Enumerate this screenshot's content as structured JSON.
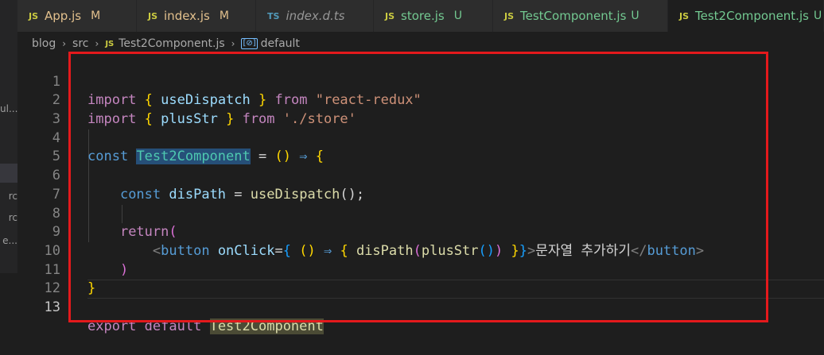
{
  "tabs": [
    {
      "icon": "JS",
      "label": "App.js",
      "status": "M",
      "state": "modified",
      "italic": false,
      "active": false
    },
    {
      "icon": "JS",
      "label": "index.js",
      "status": "M",
      "state": "modified",
      "italic": false,
      "active": false
    },
    {
      "icon": "TS",
      "label": "index.d.ts",
      "status": "",
      "state": "normal",
      "italic": true,
      "active": false
    },
    {
      "icon": "JS",
      "label": "store.js",
      "status": "U",
      "state": "new",
      "italic": false,
      "active": false
    },
    {
      "icon": "JS",
      "label": "TestComponent.js",
      "status": "U",
      "state": "new",
      "italic": false,
      "active": false
    },
    {
      "icon": "JS",
      "label": "Test2Component.js",
      "status": "U",
      "state": "new",
      "italic": false,
      "active": true
    }
  ],
  "breadcrumb": {
    "items": [
      "blog",
      "src"
    ],
    "file_icon": "JS",
    "file": "Test2Component.js",
    "symbol_icon": "[⊘]",
    "symbol": "default"
  },
  "sidebar_fragments": [
    "ul...",
    "rc",
    "rc",
    "e..."
  ],
  "editor": {
    "current_line": 13,
    "line_numbers": [
      "1",
      "2",
      "3",
      "4",
      "5",
      "6",
      "7",
      "8",
      "9",
      "10",
      "11",
      "12",
      "13"
    ],
    "tokens": {
      "l1": [
        "import",
        "{",
        "useDispatch",
        "}",
        "from",
        "\"react-redux\""
      ],
      "l2": [
        "import",
        "{",
        "plusStr",
        "}",
        "from",
        "'./store'"
      ],
      "l4": [
        "const",
        "Test2Component",
        "=",
        "()",
        "⇒",
        "{"
      ],
      "l6": [
        "const",
        "disPath",
        "=",
        "useDispatch",
        "();"
      ],
      "l8": [
        "return",
        "("
      ],
      "l9": [
        "<",
        "button",
        "onClick",
        "=",
        "{",
        "()",
        "⇒",
        "{",
        "disPath",
        "(",
        "plusStr",
        "()",
        ")",
        "}",
        "}",
        ">",
        "문자열 추가하기",
        "</",
        "button",
        ">"
      ],
      "l10": [
        ")"
      ],
      "l11": [
        "}"
      ],
      "l13": [
        "export",
        "default",
        "Test2Component"
      ]
    }
  },
  "colors": {
    "annotation_box": "#e4191c",
    "keyword": "#c586c0",
    "string": "#ce9178",
    "variable": "#9cdcfe"
  }
}
